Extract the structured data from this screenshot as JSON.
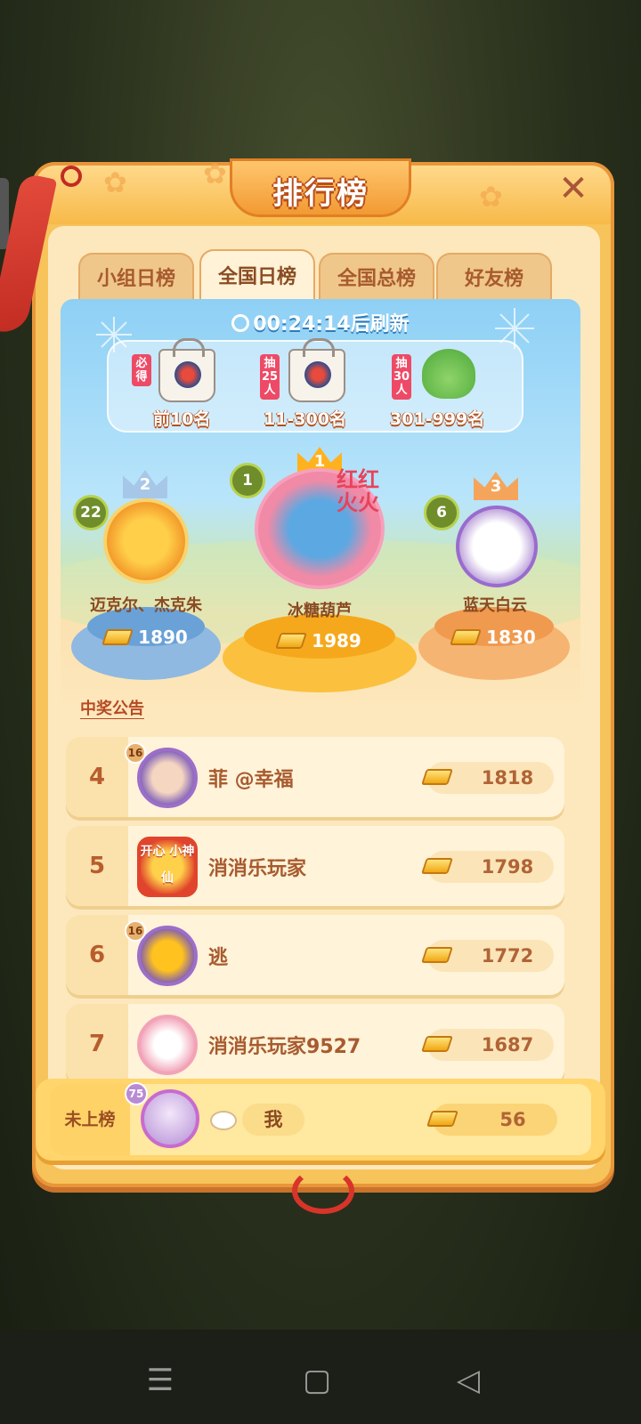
{
  "header": {
    "title": "排行榜",
    "close_icon": "close-icon"
  },
  "tabs": [
    {
      "label": "小组日榜",
      "active": false
    },
    {
      "label": "全国日榜",
      "active": true
    },
    {
      "label": "全国总榜",
      "active": false
    },
    {
      "label": "好友榜",
      "active": false
    }
  ],
  "refresh": {
    "time": "00:24:14",
    "suffix": "后刷新"
  },
  "prizes": [
    {
      "tag": "必得",
      "label": "前10名",
      "icon": "gift-bag-icon"
    },
    {
      "tag": "抽25人",
      "label": "11-300名",
      "icon": "gift-bag-icon"
    },
    {
      "tag": "抽30人",
      "label": "301-999名",
      "icon": "frog-plush-icon"
    }
  ],
  "podium": [
    {
      "rank": "2",
      "level": "22",
      "name": "迈克尔、杰克朱",
      "score": "1890"
    },
    {
      "rank": "1",
      "level": "1",
      "name": "冰糖葫芦",
      "score": "1989",
      "frame_text": "红红火火"
    },
    {
      "rank": "3",
      "level": "6",
      "name": "蓝天白云",
      "score": "1830"
    }
  ],
  "announcement_link": "中奖公告",
  "ranks": [
    {
      "rank": "4",
      "level": "16",
      "name": "菲 @幸福",
      "score": "1818"
    },
    {
      "rank": "5",
      "level": "",
      "name": "消消乐玩家",
      "score": "1798",
      "frame_text": "开心 小神仙"
    },
    {
      "rank": "6",
      "level": "16",
      "name": "逃",
      "score": "1772"
    },
    {
      "rank": "7",
      "level": "",
      "name": "消消乐玩家9527",
      "score": "1687"
    }
  ],
  "me": {
    "status": "未上榜",
    "level": "75",
    "name": "我",
    "score": "56"
  },
  "navbar": {
    "menu_icon": "☰",
    "home_icon": "▢",
    "back_icon": "◁"
  },
  "colors": {
    "panel": "#f7c35b",
    "accent": "#e9963a",
    "text_brown": "#a75b2f",
    "sky": "#8ed0f5"
  }
}
